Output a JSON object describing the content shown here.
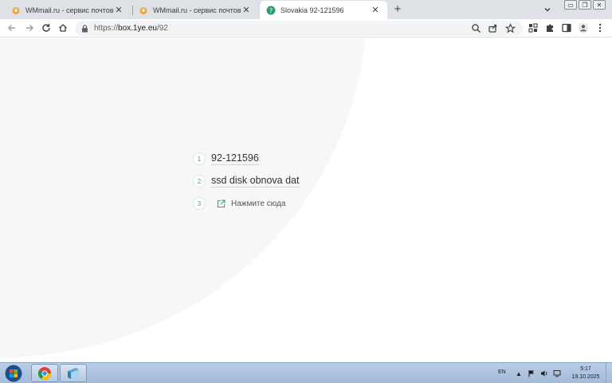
{
  "browser": {
    "tabs": [
      {
        "title": "WMmail.ru - сервис почтовых р",
        "icon": "wmmail-favicon",
        "active": false
      },
      {
        "title": "WMmail.ru - сервис почтовых р",
        "icon": "wmmail-favicon",
        "active": false
      },
      {
        "title": "Slovakia 92-121596",
        "icon": "green-question-favicon",
        "active": true
      }
    ],
    "new_tab_label": "+",
    "address": {
      "scheme": "https://",
      "host": "box.1ye.eu",
      "path": "/92"
    }
  },
  "page": {
    "steps": [
      {
        "number": "1",
        "text": "92-121596"
      },
      {
        "number": "2",
        "text": "ssd disk obnova dat"
      },
      {
        "number": "3",
        "link_text": "Нажмите сюда",
        "icon": "external-link-icon"
      }
    ],
    "accent_color": "#3aa57a"
  },
  "taskbar": {
    "language": "EN",
    "time": "5:17",
    "date": "19.10.2025",
    "pinned": [
      "windows-start",
      "chrome",
      "file-manager"
    ]
  }
}
